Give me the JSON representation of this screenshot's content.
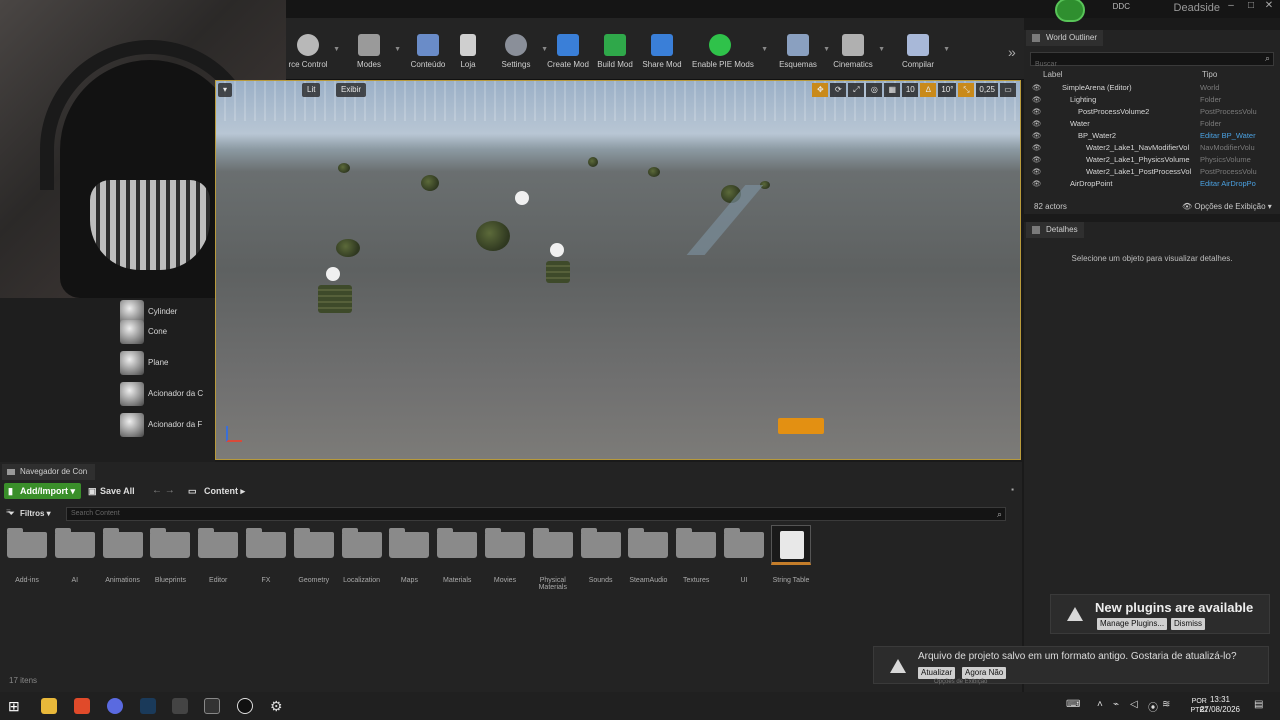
{
  "titlebar": {
    "project": "Deadside",
    "ddc": "DDC"
  },
  "toolbar": {
    "buttons": [
      {
        "label": "rce Control"
      },
      {
        "label": "Modes"
      },
      {
        "label": "Conteúdo"
      },
      {
        "label": "Loja"
      },
      {
        "label": "Settings"
      },
      {
        "label": "Create Mod"
      },
      {
        "label": "Build Mod"
      },
      {
        "label": "Share Mod"
      },
      {
        "label": "Enable PIE Mods"
      },
      {
        "label": "Esquemas"
      },
      {
        "label": "Cinematics"
      },
      {
        "label": "Compilar"
      }
    ],
    "colors": {
      "create": "#3a7fd8",
      "build": "#2fa84a",
      "share": "#3a7fd8",
      "pie": "#2fc24a"
    }
  },
  "viewport": {
    "chips": [
      "Lit",
      "Exibir"
    ],
    "right_tools": [
      "10",
      "10°",
      "0,25"
    ]
  },
  "place_panel": {
    "items": [
      "Cylinder",
      "Cone",
      "Plane",
      "Acionador da C",
      "Acionador da F"
    ]
  },
  "outliner": {
    "tab": "World Outliner",
    "search_placeholder": "Buscar",
    "col_label": "Label",
    "col_type": "Tipo",
    "rows": [
      {
        "name": "SimpleArena (Editor)",
        "type": "World",
        "indent": 0,
        "link": false
      },
      {
        "name": "Lighting",
        "type": "Folder",
        "indent": 1,
        "link": false
      },
      {
        "name": "PostProcessVolume2",
        "type": "PostProcessVolu",
        "indent": 2,
        "link": false
      },
      {
        "name": "Water",
        "type": "Folder",
        "indent": 1,
        "link": false
      },
      {
        "name": "BP_Water2",
        "type": "Editar BP_Water",
        "indent": 2,
        "link": true
      },
      {
        "name": "Water2_Lake1_NavModifierVol",
        "type": "NavModifierVolu",
        "indent": 3,
        "link": false
      },
      {
        "name": "Water2_Lake1_PhysicsVolume",
        "type": "PhysicsVolume",
        "indent": 3,
        "link": false
      },
      {
        "name": "Water2_Lake1_PostProcessVol",
        "type": "PostProcessVolu",
        "indent": 3,
        "link": false
      },
      {
        "name": "AirDropPoint",
        "type": "Editar AirDropPo",
        "indent": 1,
        "link": true
      }
    ],
    "actor_count": "82 actors",
    "view_options": "Opções de Exibição"
  },
  "details": {
    "tab": "Detalhes",
    "message": "Selecione um objeto para visualizar detalhes."
  },
  "content_browser": {
    "tab": "Navegador de Con",
    "add_import": "Add/Import",
    "save_all": "Save All",
    "breadcrumb": "Content",
    "filters": "Filtros",
    "search_placeholder": "Search Content",
    "folders": [
      "Add-ins",
      "AI",
      "Animations",
      "Blueprints",
      "Editor",
      "FX",
      "Geometry",
      "Localization",
      "Maps",
      "Materials",
      "Movies",
      "Physical Materials",
      "Sounds",
      "SteamAudio",
      "Textures",
      "UI"
    ],
    "string_table": "String Table",
    "item_count": "17 itens"
  },
  "notifications": {
    "plugins_title": "New plugins are available",
    "manage": "Manage Plugins...",
    "dismiss": "Dismiss",
    "update_title": "Arquivo de projeto salvo em um formato antigo. Gostaria de atualizá-lo?",
    "update": "Atualizar",
    "not_now": "Agora Não",
    "behind_text": "Opções de Exibição"
  },
  "taskbar": {
    "lang_top": "POR",
    "lang_bottom": "PTB2",
    "time": "13:31",
    "date": "27/08/2026"
  }
}
